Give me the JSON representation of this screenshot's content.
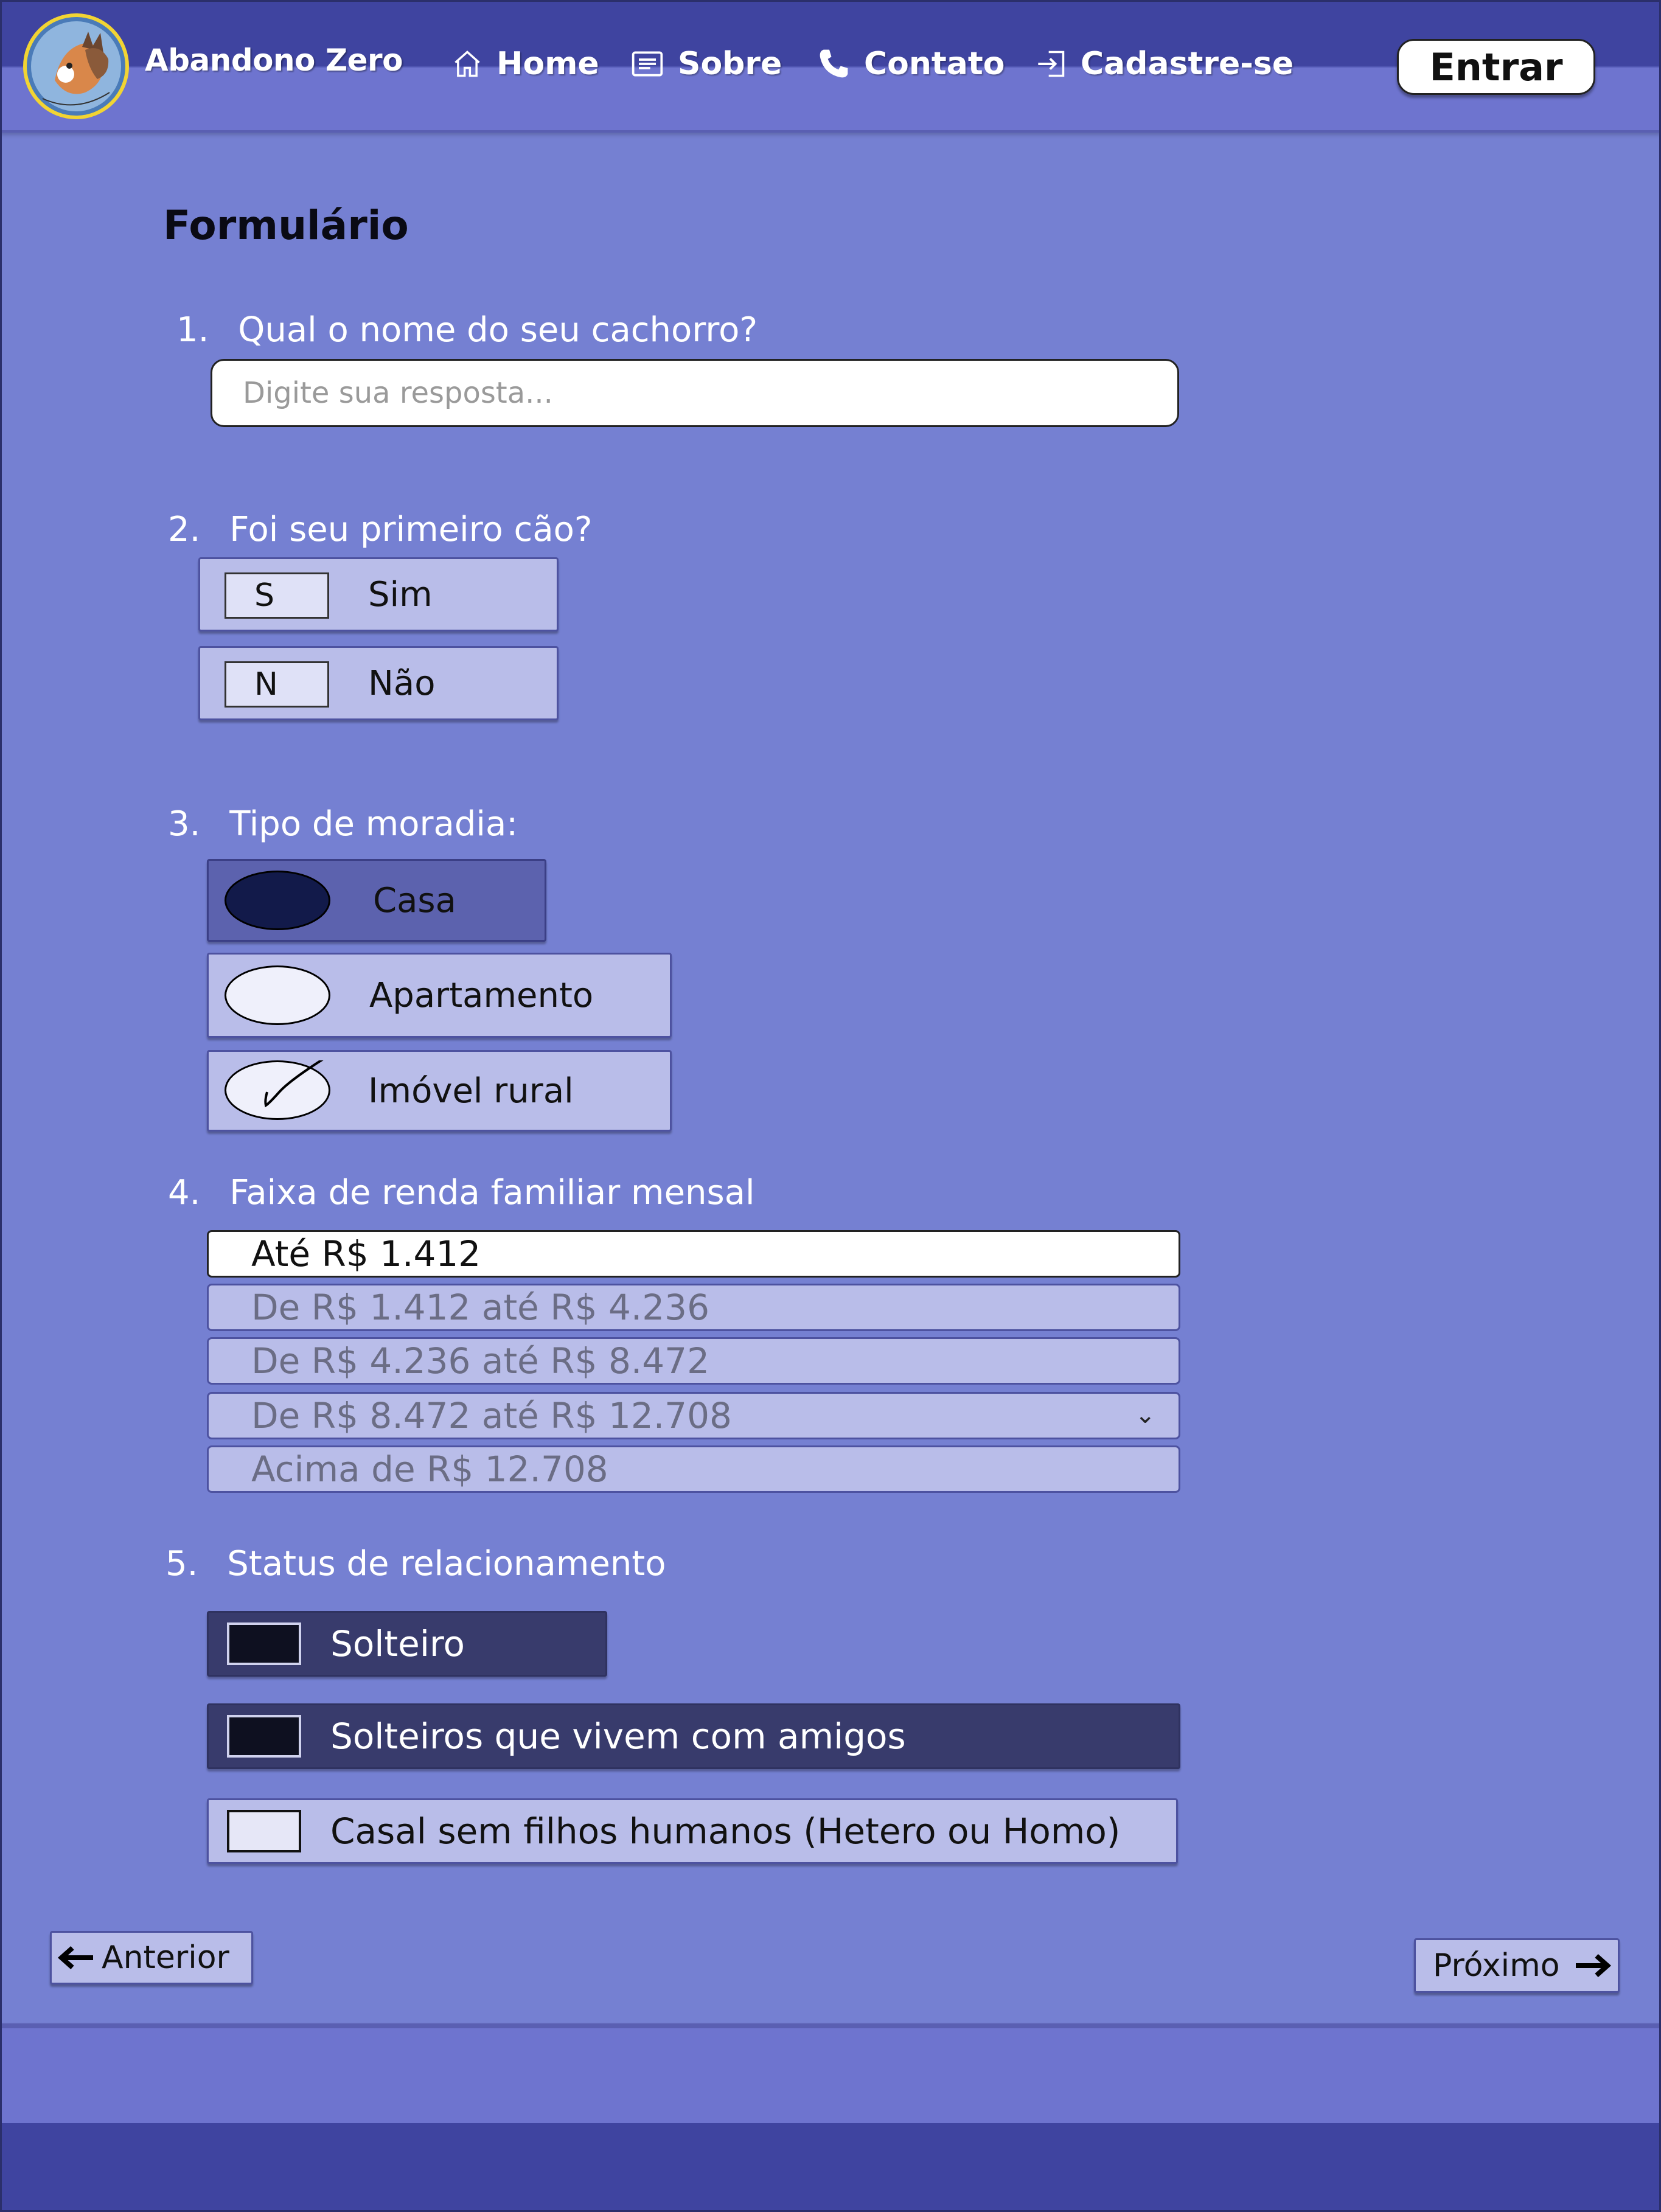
{
  "header": {
    "brand": "Abandono Zero",
    "nav": [
      {
        "label": "Home",
        "icon": "home-icon"
      },
      {
        "label": "Sobre",
        "icon": "document-icon"
      },
      {
        "label": "Contato",
        "icon": "phone-icon"
      },
      {
        "label": "Cadastre-se",
        "icon": "login-arrow-icon"
      }
    ],
    "login_label": "Entrar"
  },
  "form": {
    "title": "Formulário",
    "q1": {
      "num": "1.",
      "text": "Qual o nome do seu cachorro?",
      "placeholder": "Digite sua resposta..."
    },
    "q2": {
      "num": "2.",
      "text": "Foi seu primeiro cão?",
      "options": [
        {
          "key": "S",
          "label": "Sim"
        },
        {
          "key": "N",
          "label": "Não"
        }
      ]
    },
    "q3": {
      "num": "3.",
      "text": "Tipo de moradia:",
      "options": [
        {
          "label": "Casa",
          "state": "filled"
        },
        {
          "label": "Apartamento",
          "state": "empty"
        },
        {
          "label": "Imóvel rural",
          "state": "checked"
        }
      ]
    },
    "q4": {
      "num": "4.",
      "text": "Faixa de renda familiar mensal",
      "options": [
        "Até R$ 1.412",
        "De R$ 1.412 até R$ 4.236",
        "De R$ 4.236 até R$ 8.472",
        "De R$ 8.472 até R$ 12.708",
        "Acima de R$ 12.708"
      ],
      "selected": "Até R$ 1.412",
      "chevron": "⌄"
    },
    "q5": {
      "num": "5.",
      "text": "Status de relacionamento",
      "options": [
        {
          "label": "Solteiro",
          "checked": true
        },
        {
          "label": "Solteiros que vivem com amigos",
          "checked": true
        },
        {
          "label": "Casal sem filhos humanos (Hetero ou Homo)",
          "checked": false
        }
      ]
    }
  },
  "pager": {
    "prev_label": "Anterior",
    "next_label": "Próximo"
  },
  "colors": {
    "bg": "#7580d2",
    "header_dark": "#3f44a0",
    "header_light": "#6e74cf",
    "option_bg": "#b9bde9",
    "selected_dark": "#383b6c"
  }
}
